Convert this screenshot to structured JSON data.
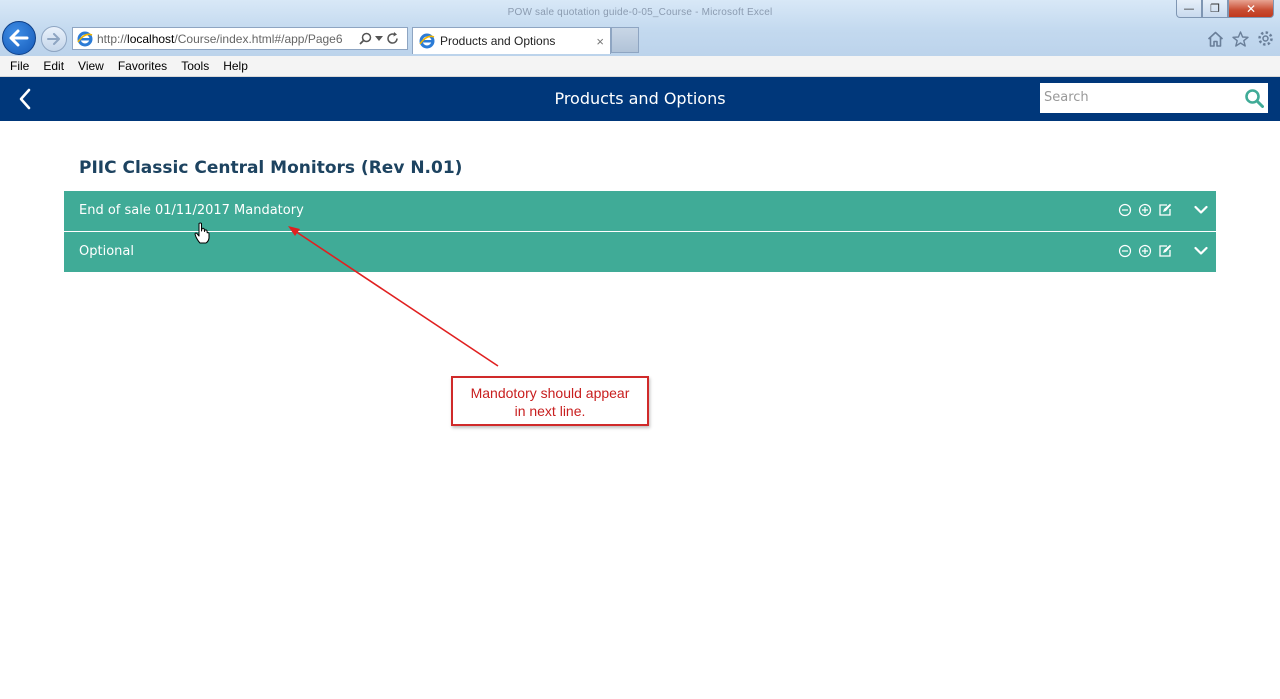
{
  "window": {
    "title": "POW sale quotation guide-0-05_Course - Microsoft Excel",
    "minimize": "—",
    "restore": "❐",
    "close": "✕"
  },
  "browser": {
    "url_prefix": "http://",
    "url_host": "localhost",
    "url_path": "/Course/index.html#/app/Page6",
    "tab_title": "Products and Options",
    "tab_close": "×"
  },
  "menu": [
    "File",
    "Edit",
    "View",
    "Favorites",
    "Tools",
    "Help"
  ],
  "app": {
    "title": "Products and Options",
    "search_placeholder": "Search",
    "accent": "#00377a",
    "row_color": "#40ab97"
  },
  "page": {
    "heading": "PIIC Classic Central Monitors (Rev N.01)",
    "rows": [
      {
        "label": "End of sale 01/11/2017 Mandatory"
      },
      {
        "label": "Optional"
      }
    ]
  },
  "annotation": {
    "line1": "Mandotory should appear",
    "line2": "in next line.",
    "color": "#d02a2a"
  }
}
